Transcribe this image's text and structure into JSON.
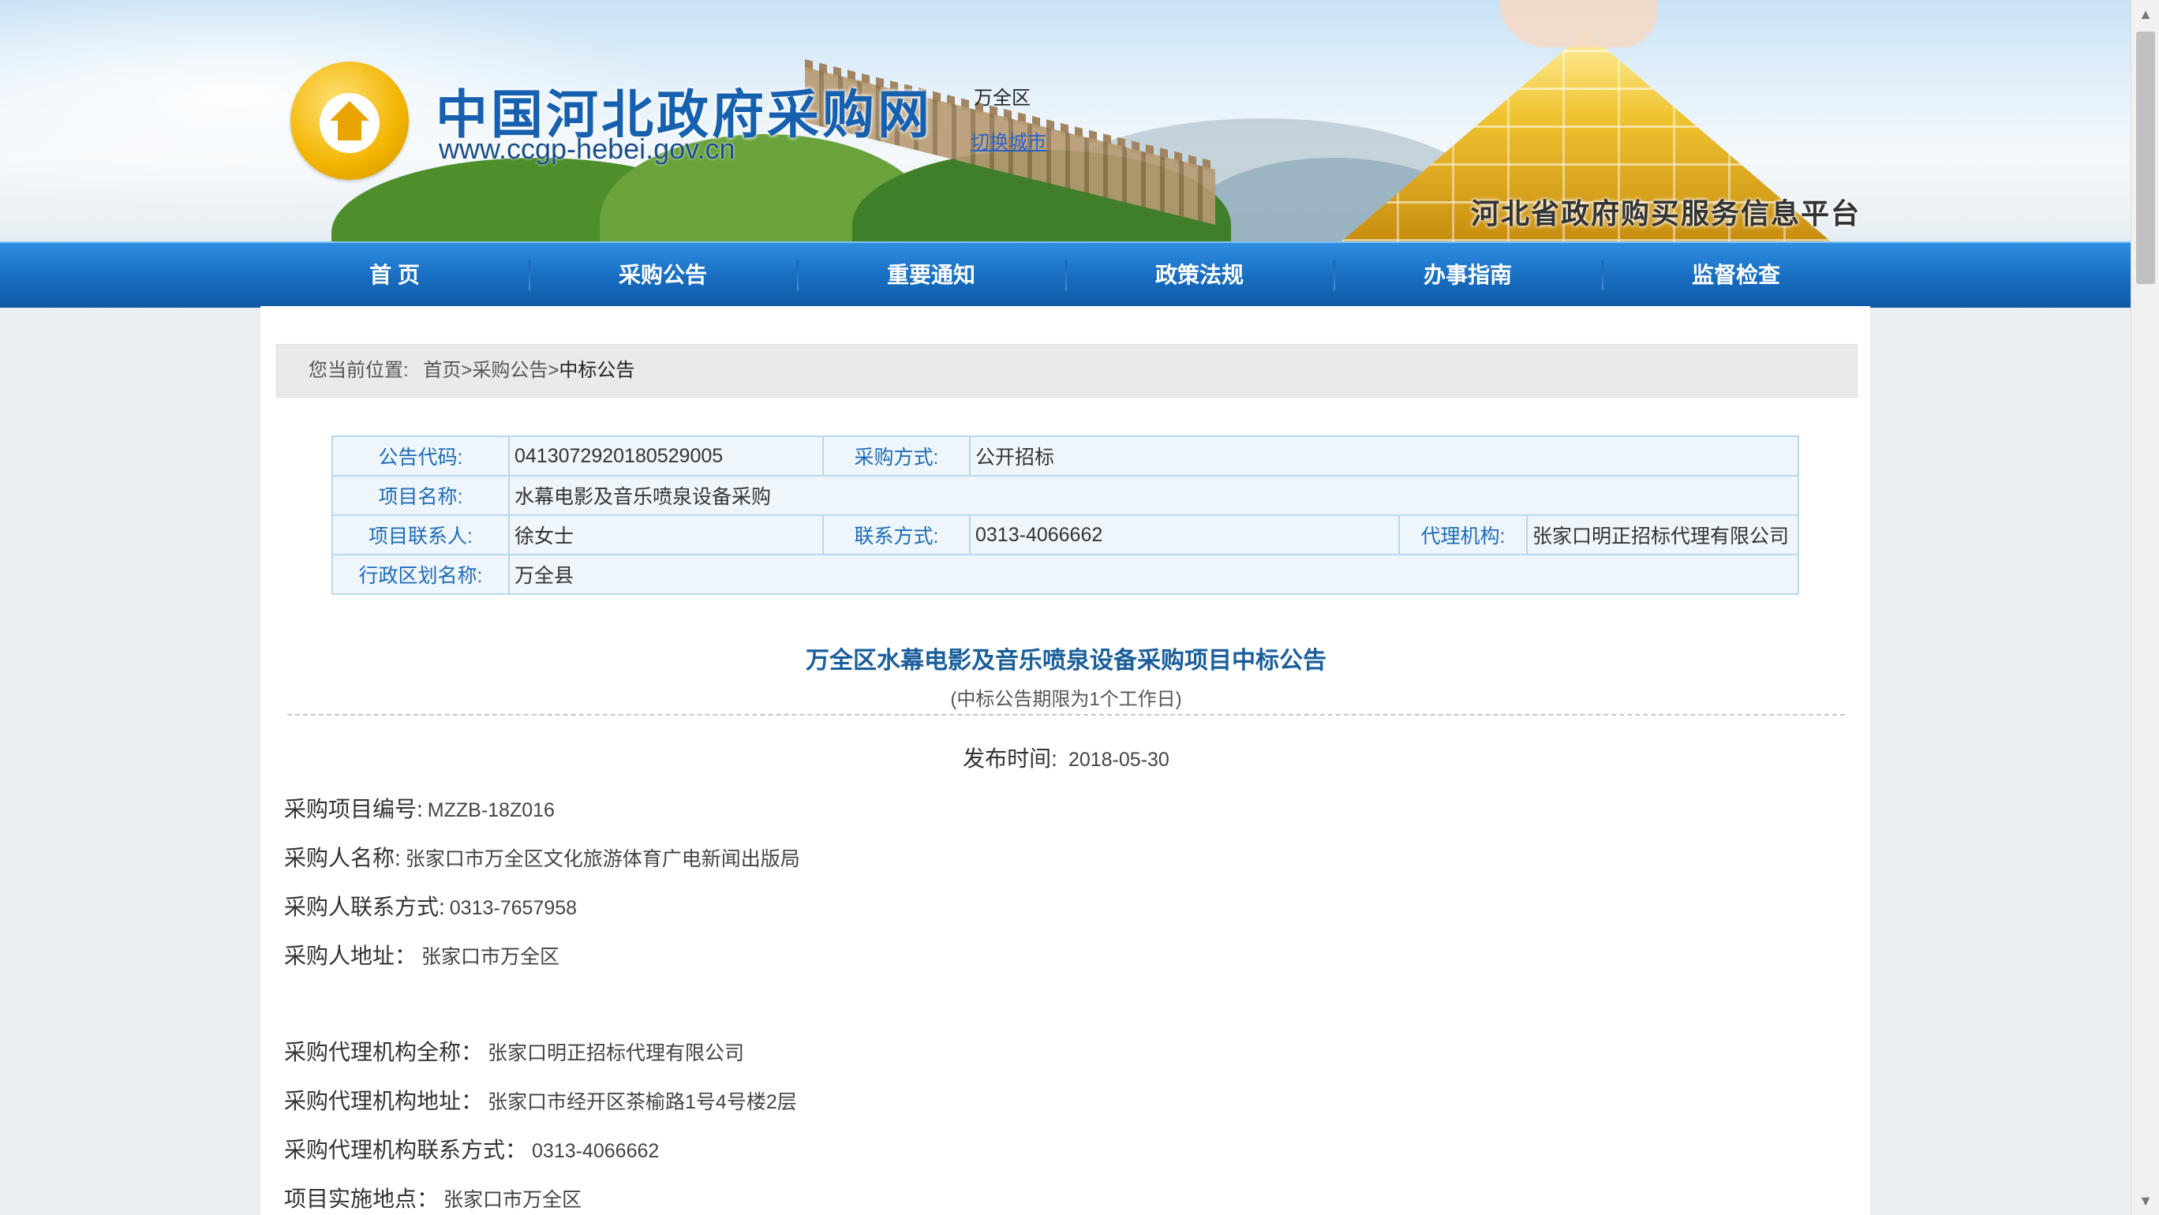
{
  "header": {
    "site_title": "中国河北政府采购网",
    "site_url": "www.ccgp-hebei.gov.cn",
    "city": "万全区",
    "switch_city": "切换城市",
    "platform": "河北省政府购买服务信息平台"
  },
  "nav": {
    "items": [
      "首 页",
      "采购公告",
      "重要通知",
      "政策法规",
      "办事指南",
      "监督检查"
    ]
  },
  "breadcrumb": {
    "label": "您当前位置:",
    "items": [
      "首页",
      "采购公告",
      "中标公告"
    ],
    "separator": ">"
  },
  "info_table": {
    "code_label": "公告代码:",
    "code": "0413072920180529005",
    "method_label": "采购方式:",
    "method": "公开招标",
    "project_label": "项目名称:",
    "project": "水幕电影及音乐喷泉设备采购",
    "contact_label": "项目联系人:",
    "contact": "徐女士",
    "phone_label": "联系方式:",
    "phone": "0313-4066662",
    "agency_label": "代理机构:",
    "agency": "张家口明正招标代理有限公司",
    "region_label": "行政区划名称:",
    "region": "万全县"
  },
  "announcement": {
    "title": "万全区水幕电影及音乐喷泉设备采购项目中标公告",
    "subtitle": "(中标公告期限为1个工作日)",
    "publish_label": "发布时间:",
    "publish_date": "2018-05-30",
    "fields": [
      {
        "label": "采购项目编号:",
        "value": "MZZB-18Z016"
      },
      {
        "label": "采购人名称:",
        "value": "张家口市万全区文化旅游体育广电新闻出版局"
      },
      {
        "label": "采购人联系方式:",
        "value": "0313-7657958"
      },
      {
        "label": "采购人地址：",
        "value": "张家口市万全区"
      },
      {
        "label": "采购代理机构全称：",
        "value": "张家口明正招标代理有限公司"
      },
      {
        "label": "采购代理机构地址：",
        "value": "张家口市经开区茶榆路1号4号楼2层"
      },
      {
        "label": "采购代理机构联系方式：",
        "value": "0313-4066662"
      },
      {
        "label": "项目实施地点：",
        "value": "张家口市万全区"
      }
    ]
  }
}
